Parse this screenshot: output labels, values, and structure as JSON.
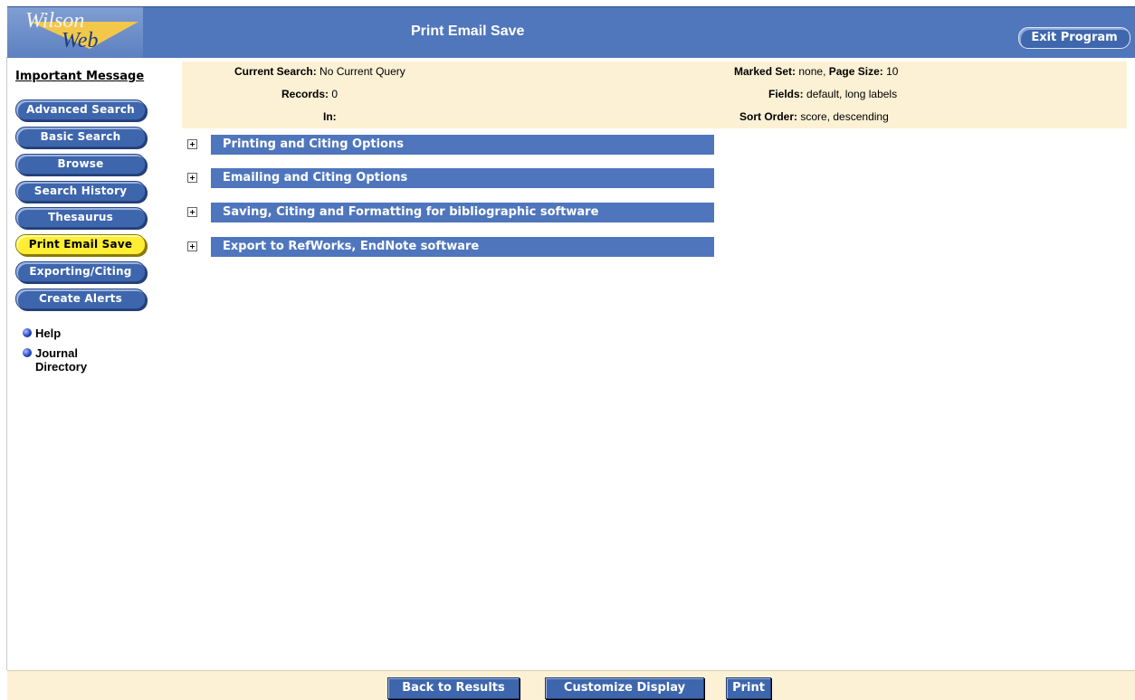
{
  "header": {
    "logo_line1": "Wilson",
    "logo_line2": "Web",
    "title": "Print Email Save",
    "exit_label": "Exit Program"
  },
  "sidebar": {
    "important_message": "Important Message",
    "buttons": [
      {
        "label": "Advanced Search"
      },
      {
        "label": "Basic Search"
      },
      {
        "label": "Browse"
      },
      {
        "label": "Search History"
      },
      {
        "label": "Thesaurus"
      },
      {
        "label": "Print Email Save",
        "active": true
      },
      {
        "label": "Exporting/Citing"
      },
      {
        "label": "Create Alerts"
      }
    ],
    "links": [
      {
        "label": "Help"
      },
      {
        "label": "Journal Directory"
      }
    ]
  },
  "info": {
    "current_search_label": "Current Search:",
    "current_search_value": "No Current Query",
    "records_label": "Records:",
    "records_value": "0",
    "in_label": "In:",
    "in_value": "",
    "marked_set_label": "Marked Set:",
    "marked_set_value": "none,",
    "page_size_label": "Page Size:",
    "page_size_value": "10",
    "fields_label": "Fields:",
    "fields_value": "default, long labels",
    "sort_order_label": "Sort Order:",
    "sort_order_value": "score, descending"
  },
  "sections": [
    {
      "label": "Printing and Citing Options"
    },
    {
      "label": "Emailing and Citing Options"
    },
    {
      "label": "Saving, Citing and Formatting for bibliographic software"
    },
    {
      "label": "Export to RefWorks, EndNote software"
    }
  ],
  "footer": {
    "back_label": "Back to Results",
    "customize_label": "Customize Display",
    "print_label": "Print"
  }
}
